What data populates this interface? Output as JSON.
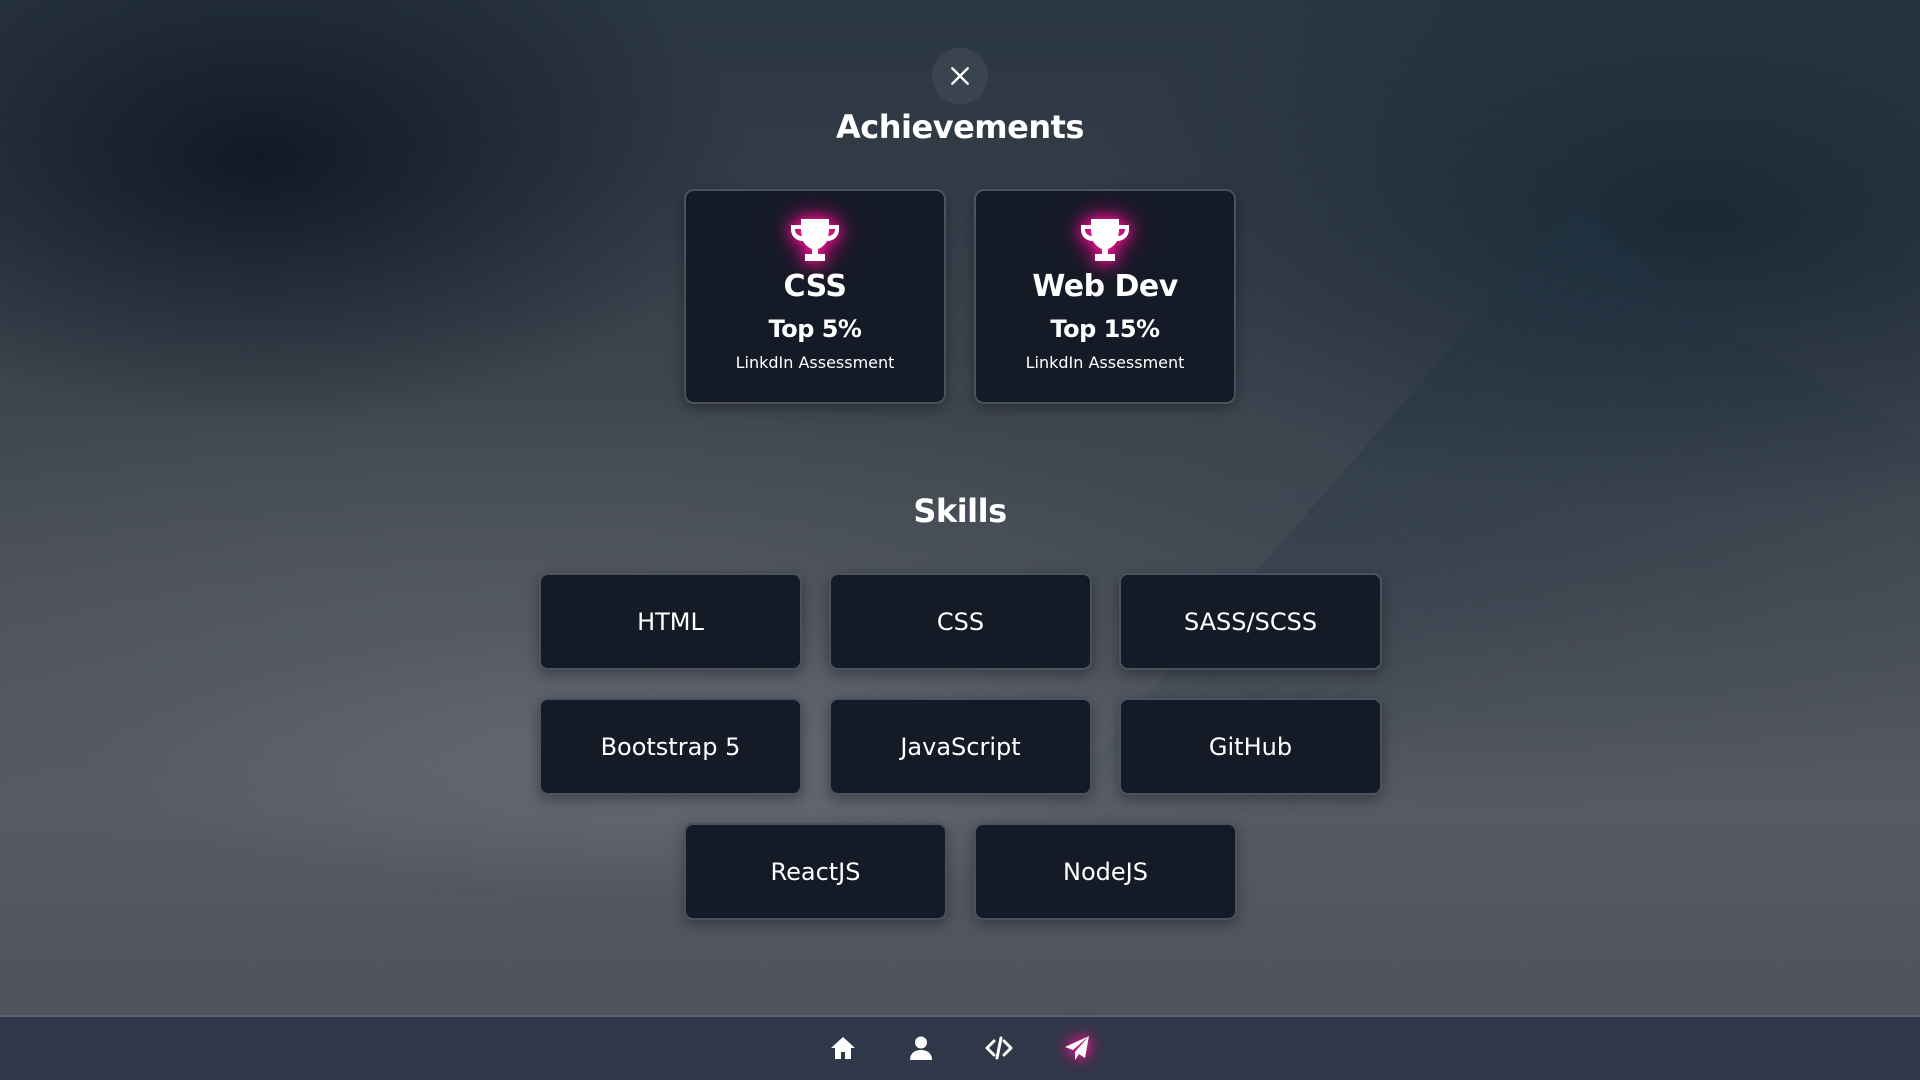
{
  "close": {
    "icon": "close-icon"
  },
  "achievements": {
    "title": "Achievements",
    "items": [
      {
        "icon": "trophy-icon",
        "name": "CSS",
        "rank": "Top 5%",
        "source": "LinkdIn Assessment"
      },
      {
        "icon": "trophy-icon",
        "name": "Web Dev",
        "rank": "Top 15%",
        "source": "LinkdIn Assessment"
      }
    ]
  },
  "skills": {
    "title": "Skills",
    "items": [
      "HTML",
      "CSS",
      "SASS/SCSS",
      "Bootstrap 5",
      "JavaScript",
      "GitHub",
      "ReactJS",
      "NodeJS"
    ]
  },
  "navbar": {
    "items": [
      {
        "icon": "home-icon",
        "active": false
      },
      {
        "icon": "user-icon",
        "active": false
      },
      {
        "icon": "code-icon",
        "active": false
      },
      {
        "icon": "paper-plane-icon",
        "active": true
      }
    ]
  },
  "colors": {
    "accent_glow": "#ff1a9c",
    "card_bg": "#141a26",
    "card_border": "#4a5260",
    "navbar_bg": "#2e3848"
  }
}
